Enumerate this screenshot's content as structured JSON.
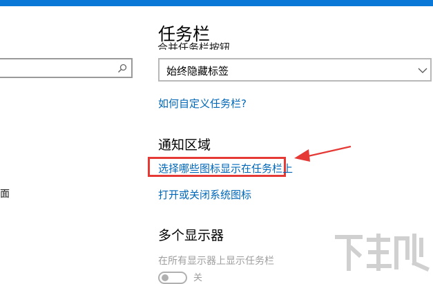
{
  "window": {
    "accent_color": "#0a78d7"
  },
  "sidebar": {
    "search": {
      "value": "",
      "icon": "search-icon"
    },
    "items": [
      {
        "label": "桌面"
      }
    ]
  },
  "main": {
    "title": "任务栏",
    "combine_buttons": {
      "label": "合并任务栏按钮",
      "selected": "始终隐藏标签",
      "icon": "chevron-down-icon"
    },
    "help_link": "如何自定义任务栏?",
    "notification_area": {
      "heading": "通知区域",
      "select_icons_link": "选择哪些图标显示在任务栏上",
      "system_icons_link": "打开或关闭系统图标"
    },
    "multiple_displays": {
      "heading": "多个显示器",
      "show_taskbar_label": "在所有显示器上显示任务栏",
      "toggle_state": "关"
    }
  },
  "annotation": {
    "highlight_color": "#e53935"
  },
  "watermark": {
    "text": "下载吧"
  }
}
